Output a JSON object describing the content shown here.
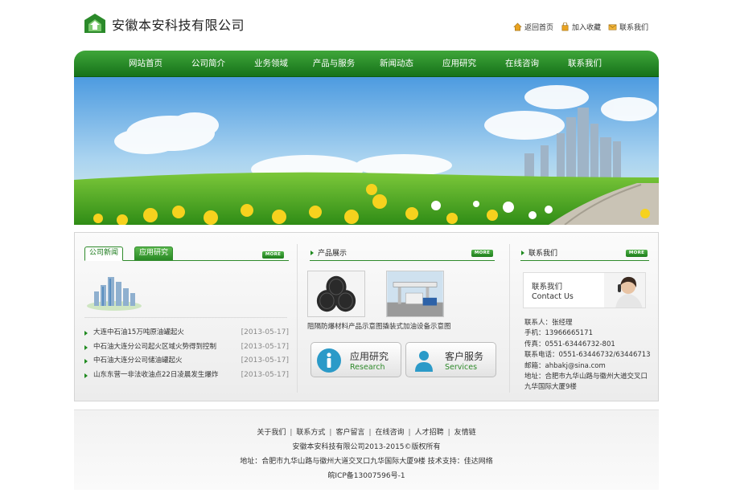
{
  "header": {
    "company_name": "安徽本安科技有限公司",
    "top_links": [
      {
        "label": "返回首页",
        "icon": "home-icon"
      },
      {
        "label": "加入收藏",
        "icon": "bookmark-icon"
      },
      {
        "label": "联系我们",
        "icon": "mail-icon"
      }
    ]
  },
  "nav": {
    "items": [
      "网站首页",
      "公司简介",
      "业务领域",
      "产品与服务",
      "新闻动态",
      "应用研究",
      "在线咨询",
      "联系我们"
    ]
  },
  "news": {
    "tabs": [
      "公司新闻",
      "应用研究"
    ],
    "more_label": "MORE",
    "items": [
      {
        "title": "大连中石油15万吨原油罐起火",
        "date": "[2013-05-17]"
      },
      {
        "title": "中石油大连分公司起火区域火势得到控制",
        "date": "[2013-05-17]"
      },
      {
        "title": "中石油大连分公司储油罐起火",
        "date": "[2013-05-17]"
      },
      {
        "title": "山东东营一非法收油点22日凌晨发生爆炸",
        "date": "[2013-05-17]"
      }
    ]
  },
  "products": {
    "title": "产品展示",
    "more_label": "MORE",
    "caption": "阻隔防爆材料产品示意图撬装式加油设备示意图",
    "services": [
      {
        "cn": "应用研究",
        "en": "Research",
        "icon": "info-icon"
      },
      {
        "cn": "客户服务",
        "en": "Services",
        "icon": "person-icon"
      }
    ]
  },
  "contact": {
    "title": "联系我们",
    "more_label": "MORE",
    "banner_cn": "联系我们",
    "banner_en": "Contact Us",
    "lines": [
      "联系人：张经理",
      "手机：13966665171",
      "传真：0551-63446732-801",
      "联系电话：0551-63446732/63446713",
      "邮箱：ahbakj@sina.com",
      "地址：合肥市九华山路与徽州大道交叉口九华国际大厦9楼"
    ]
  },
  "footer": {
    "links": [
      "关于我们",
      "联系方式",
      "客户留言",
      "在线咨询",
      "人才招聘",
      "友情链"
    ],
    "copyright": "安徽本安科技有限公司2013-2015©版权所有",
    "address": "地址：合肥市九华山路与徽州大道交叉口九华国际大厦9楼  技术支持：佳达网络",
    "icp": "皖ICP备13007596号-1"
  },
  "colors": {
    "brand_green": "#2e8a2a",
    "nav_green_top": "#3fa63a",
    "nav_green_bottom": "#16721a"
  }
}
